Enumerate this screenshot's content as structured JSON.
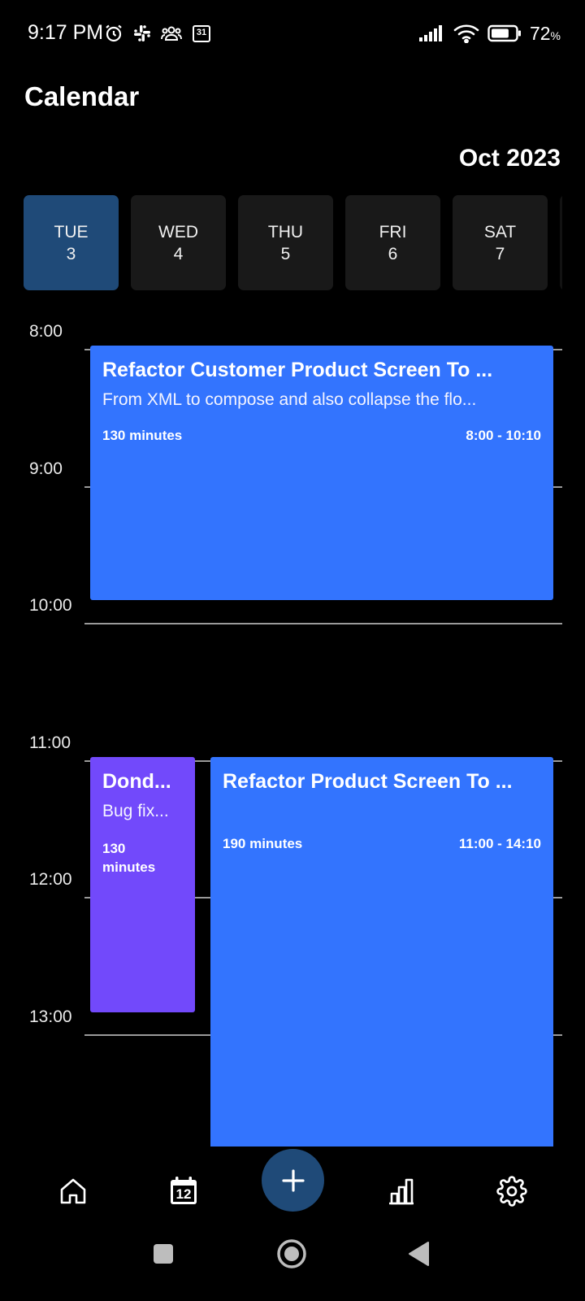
{
  "status_bar": {
    "time": "9:17 PM",
    "calendar_badge": "31",
    "battery_percent": "72",
    "battery_unit": "%",
    "battery_level": 0.72
  },
  "header": {
    "title": "Calendar",
    "month": "Oct 2023"
  },
  "days": [
    {
      "dow": "TUE",
      "date": "3",
      "selected": true
    },
    {
      "dow": "WED",
      "date": "4",
      "selected": false
    },
    {
      "dow": "THU",
      "date": "5",
      "selected": false
    },
    {
      "dow": "FRI",
      "date": "6",
      "selected": false
    },
    {
      "dow": "SAT",
      "date": "7",
      "selected": false
    }
  ],
  "hours": [
    "8:00",
    "9:00",
    "10:00",
    "11:00",
    "12:00",
    "13:00"
  ],
  "events": [
    {
      "title": "Refactor Customer Product Screen To ...",
      "description": "From XML to compose and also collapse the flo...",
      "duration": "130 minutes",
      "time_range": "8:00 - 10:10",
      "color": "#3374fe"
    },
    {
      "title": "Dond...",
      "description": "Bug fix...",
      "duration_line1": "130",
      "duration_line2": "minutes",
      "color": "#7249fb"
    },
    {
      "title": "Refactor Product Screen To ...",
      "duration": "190 minutes",
      "time_range": "11:00 - 14:10",
      "color": "#3374fe"
    }
  ],
  "bottom_nav": {
    "calendar_icon_number": "12",
    "items": [
      "home-icon",
      "calendar-icon",
      "add-icon",
      "stats-icon",
      "settings-icon"
    ]
  },
  "colors": {
    "accent": "#1f4a78",
    "event_blue": "#3374fe",
    "event_purple": "#7249fb"
  }
}
